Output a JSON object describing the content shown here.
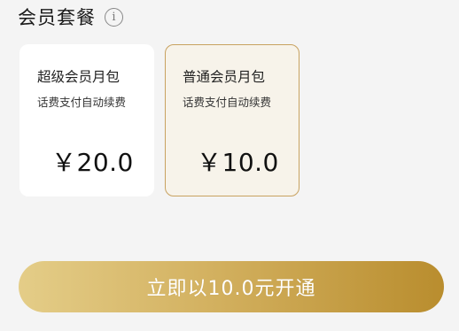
{
  "section": {
    "title": "会员套餐",
    "info_icon": "info-icon"
  },
  "plans": [
    {
      "name": "超级会员月包",
      "desc": "话费支付自动续费",
      "price": "￥20.0",
      "selected": false
    },
    {
      "name": "普通会员月包",
      "desc": "话费支付自动续费",
      "price": "￥10.0",
      "selected": true
    }
  ],
  "colors": {
    "accent": "#c8a260",
    "selected_card_bg": "#f7f3ea",
    "button_gradient_start": "#e4cd88",
    "button_gradient_end": "#b98d2e"
  },
  "action": {
    "open_label": "立即以10.0元开通"
  }
}
